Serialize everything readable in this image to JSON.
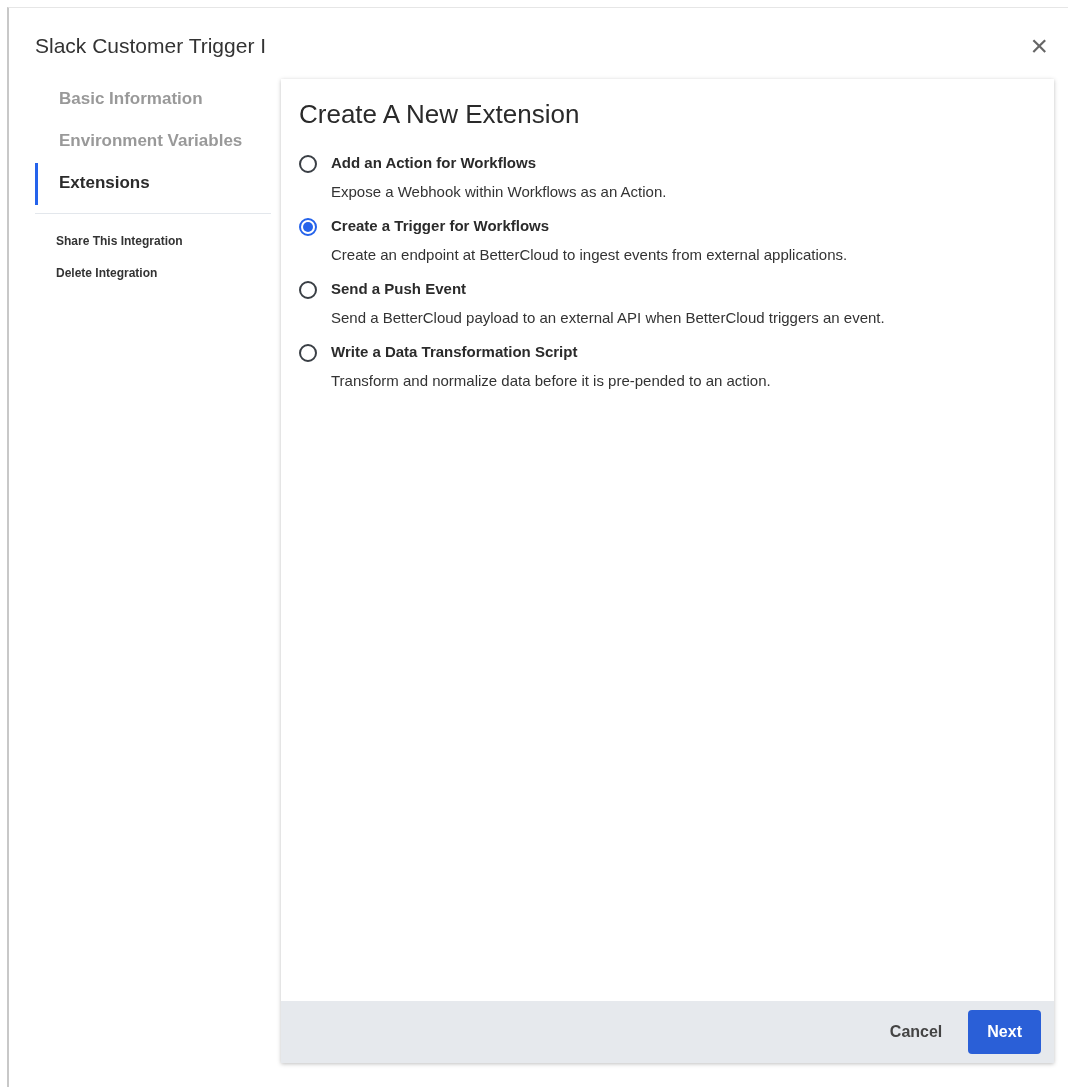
{
  "dialog": {
    "title": "Slack Customer Trigger I",
    "close": "×"
  },
  "sidebar": {
    "items": [
      {
        "label": "Basic Information",
        "selected": false
      },
      {
        "label": "Environment Variables",
        "selected": false
      },
      {
        "label": "Extensions",
        "selected": true
      }
    ],
    "links": [
      "Share This Integration",
      "Delete Integration"
    ]
  },
  "panel": {
    "title": "Create A New Extension",
    "options": [
      {
        "label": "Add an Action for Workflows",
        "description": "Expose a Webhook within Workflows as an Action.",
        "selected": false
      },
      {
        "label": "Create a Trigger for Workflows",
        "description": "Create an endpoint at BetterCloud to ingest events from external applications.",
        "selected": true
      },
      {
        "label": "Send a Push Event",
        "description": "Send a BetterCloud payload to an external API when BetterCloud triggers an event.",
        "selected": false
      },
      {
        "label": "Write a Data Transformation Script",
        "description": "Transform and normalize data before it is pre-pended to an action.",
        "selected": false
      }
    ],
    "buttons": {
      "cancel": "Cancel",
      "next": "Next"
    }
  }
}
